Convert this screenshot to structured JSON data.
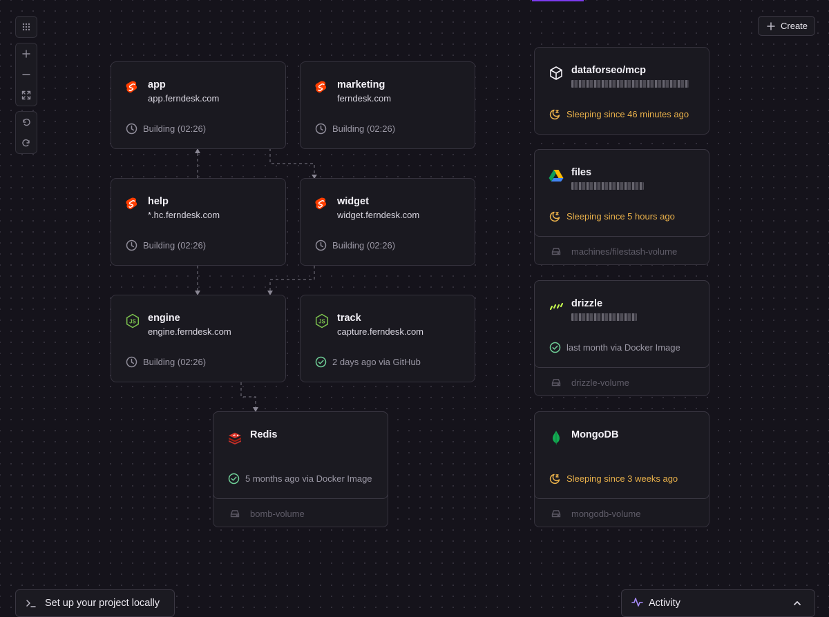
{
  "toolbar": {
    "create_label": "Create"
  },
  "services": {
    "app": {
      "name": "app",
      "domain": "app.ferndesk.com",
      "status": "Building (02:26)",
      "icon": "svelte-icon"
    },
    "marketing": {
      "name": "marketing",
      "domain": "ferndesk.com",
      "status": "Building (02:26)",
      "icon": "svelte-icon"
    },
    "help": {
      "name": "help",
      "domain": "*.hc.ferndesk.com",
      "status": "Building (02:26)",
      "icon": "svelte-icon"
    },
    "widget": {
      "name": "widget",
      "domain": "widget.ferndesk.com",
      "status": "Building (02:26)",
      "icon": "svelte-icon"
    },
    "engine": {
      "name": "engine",
      "domain": "engine.ferndesk.com",
      "status": "Building (02:26)",
      "icon": "nodejs-icon"
    },
    "track": {
      "name": "track",
      "domain": "capture.ferndesk.com",
      "status": "2 days ago via GitHub",
      "icon": "nodejs-icon"
    },
    "redis": {
      "name": "Redis",
      "status": "5 months ago via Docker Image",
      "volume": "bomb-volume",
      "icon": "redis-icon"
    },
    "dataforseo": {
      "name": "dataforseo/mcp",
      "status": "Sleeping since 46 minutes ago",
      "icon": "package-icon"
    },
    "files": {
      "name": "files",
      "status": "Sleeping since 5 hours ago",
      "volume": "machines/filestash-volume",
      "icon": "google-drive-icon"
    },
    "drizzle": {
      "name": "drizzle",
      "status": "last month via Docker Image",
      "volume": "drizzle-volume",
      "icon": "drizzle-icon"
    },
    "mongodb": {
      "name": "MongoDB",
      "status": "Sleeping since 3 weeks ago",
      "volume": "mongodb-volume",
      "icon": "mongodb-icon"
    }
  },
  "bottom": {
    "setup_label": "Set up your project locally",
    "activity_label": "Activity"
  },
  "colors": {
    "background": "#15131b",
    "card": "#1b1a21",
    "accent": "#7c3aed",
    "sleeping": "#e8b04a",
    "success": "#6fcf97",
    "svelte": "#ff3e00",
    "nodejs": "#7cc24e"
  }
}
